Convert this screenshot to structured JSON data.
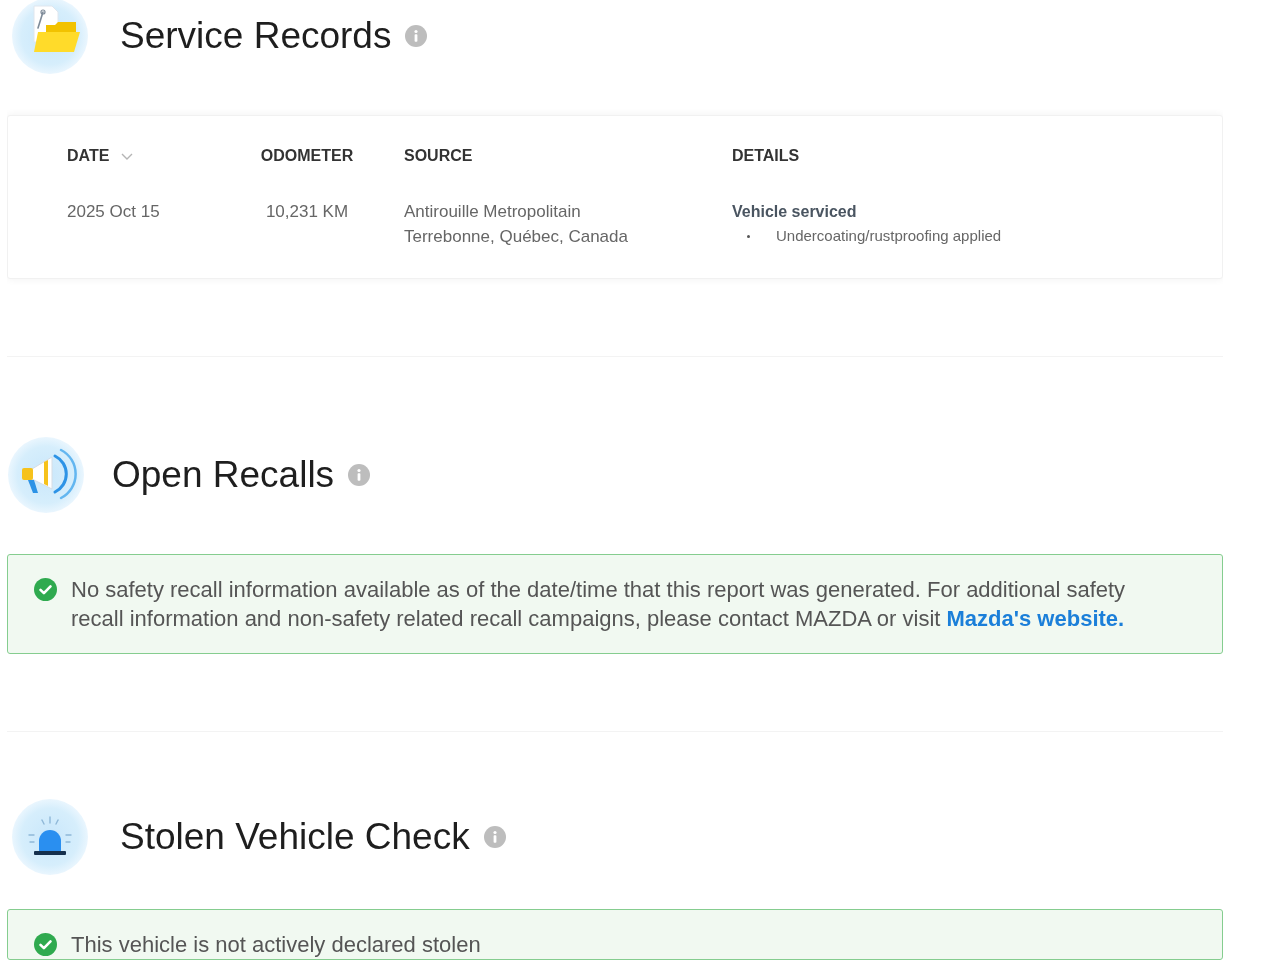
{
  "sections": [
    {
      "kind": "service_records",
      "title": "Service Records",
      "table": {
        "columns": [
          {
            "label": "DATE",
            "sorted": true
          },
          {
            "label": "ODOMETER",
            "sorted": false
          },
          {
            "label": "SOURCE",
            "sorted": false
          },
          {
            "label": "DETAILS",
            "sorted": false
          }
        ],
        "rows": [
          {
            "date": "2025 Oct 15",
            "odometer": "10,231 KM",
            "source": {
              "name": "Antirouille Metropolitain",
              "location": "Terrebonne, Québec, Canada"
            },
            "details": {
              "title": "Vehicle serviced",
              "items": [
                "Undercoating/rustproofing applied"
              ]
            }
          }
        ]
      }
    },
    {
      "kind": "open_recalls",
      "title": "Open Recalls",
      "notice": {
        "text": "No safety recall information available as of the date/time that this report was generated. For additional safety recall information and non-safety related recall campaigns, please contact MAZDA or visit",
        "link": "Mazda's website."
      }
    },
    {
      "kind": "stolen_check",
      "title": "Stolen Vehicle Check",
      "notice": {
        "text": "This vehicle is not actively declared stolen"
      }
    }
  ]
}
